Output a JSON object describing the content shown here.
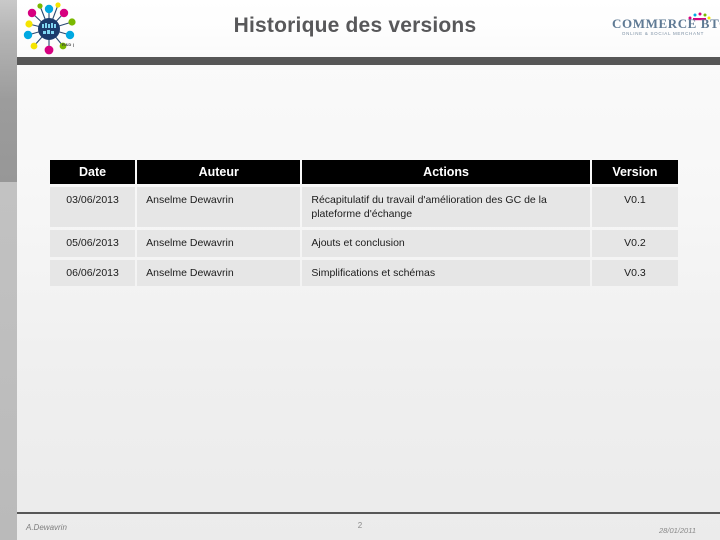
{
  "slide": {
    "title": "Historique des versions",
    "page_number": "2"
  },
  "logo_left": {
    "name": "network-hub-logo",
    "caption": "R&D |"
  },
  "logo_right": {
    "name": "commerce-btoc-logo",
    "wordmark": "COMMERCE BTOC",
    "tagline": "ONLINE & SOCIAL MERCHANT"
  },
  "table": {
    "headers": [
      "Date",
      "Auteur",
      "Actions",
      "Version"
    ],
    "rows": [
      {
        "date": "03/06/2013",
        "auteur": "Anselme Dewavrin",
        "actions": "Récapitulatif du travail d'amélioration des GC de la plateforme d'échange",
        "version": "V0.1"
      },
      {
        "date": "05/06/2013",
        "auteur": "Anselme Dewavrin",
        "actions": "Ajouts et conclusion",
        "version": "V0.2"
      },
      {
        "date": "06/06/2013",
        "auteur": "Anselme Dewavrin",
        "actions": "Simplifications et schémas",
        "version": "V0.3"
      }
    ]
  },
  "footer": {
    "author": "A.Dewavrin",
    "date": "28/01/2011"
  },
  "colors": {
    "header_bar": "#565656",
    "title_text": "#58585a",
    "table_header_bg": "#000000",
    "table_cell_bg": "#e6e6e6",
    "logo_magenta": "#d6007f",
    "logo_cyan": "#00a8e1",
    "logo_yellow": "#f5e400",
    "logo_green": "#7ab800",
    "logo_navy": "#1b3a6b"
  }
}
